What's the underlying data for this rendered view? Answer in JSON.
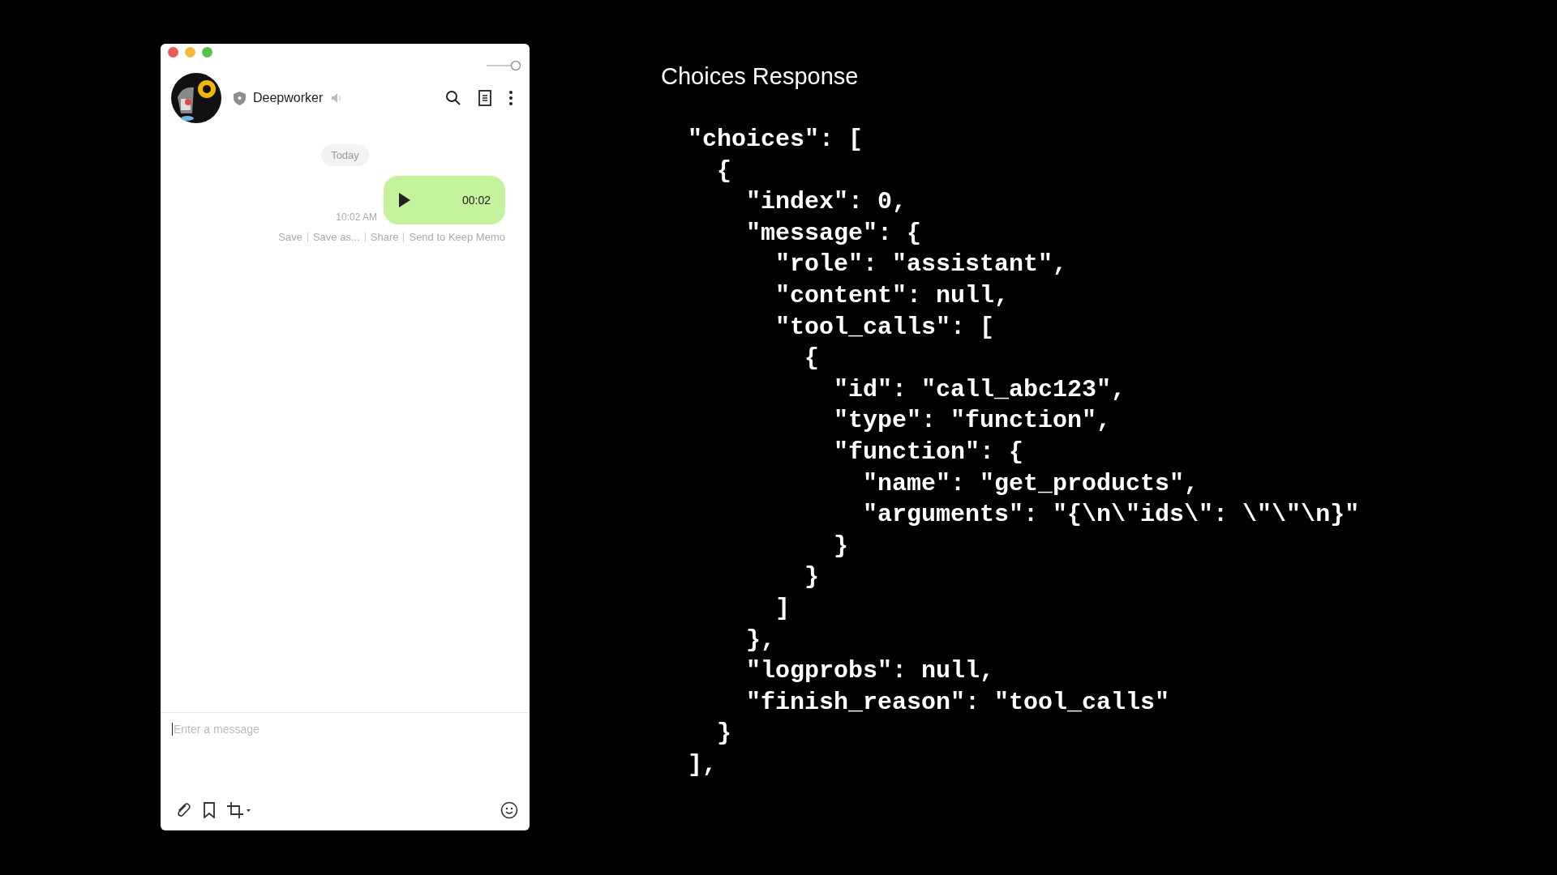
{
  "chat_window": {
    "contact": {
      "name": "Deepworker"
    },
    "date_divider": "Today",
    "messages": [
      {
        "kind": "voice",
        "duration": "00:02",
        "time": "10:02 AM",
        "actions": [
          "Save",
          "Save as...",
          "Share",
          "Send to Keep Memo"
        ]
      }
    ],
    "composer": {
      "placeholder": "Enter a message"
    }
  },
  "slide": {
    "title": "Choices Response",
    "code_lines": [
      "\"choices\": [",
      "  {",
      "    \"index\": 0,",
      "    \"message\": {",
      "      \"role\": \"assistant\",",
      "      \"content\": null,",
      "      \"tool_calls\": [",
      "        {",
      "          \"id\": \"call_abc123\",",
      "          \"type\": \"function\",",
      "          \"function\": {",
      "            \"name\": \"get_products\",",
      "            \"arguments\": \"{\\n\\\"ids\\\": \\\"\\\"\\n}\"",
      "          }",
      "        }",
      "      ]",
      "    },",
      "    \"logprobs\": null,",
      "    \"finish_reason\": \"tool_calls\"",
      "  }",
      "],"
    ]
  }
}
